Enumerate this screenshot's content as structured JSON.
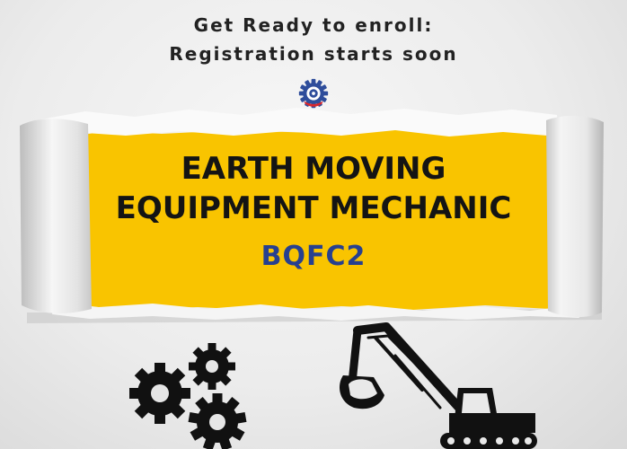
{
  "header": {
    "line1": "Get Ready to enroll:",
    "line2": "Registration starts soon"
  },
  "banner": {
    "title_line1": "EARTH MOVING",
    "title_line2": "EQUIPMENT MECHANIC",
    "code": "BQFC2"
  },
  "icons": {
    "logo": "gear-logo-icon",
    "gears": "gears-icon",
    "excavator": "excavator-icon"
  },
  "colors": {
    "banner_yellow": "#f9c400",
    "code_blue": "#27408f",
    "text_dark": "#141414",
    "paper": "#ececec"
  }
}
